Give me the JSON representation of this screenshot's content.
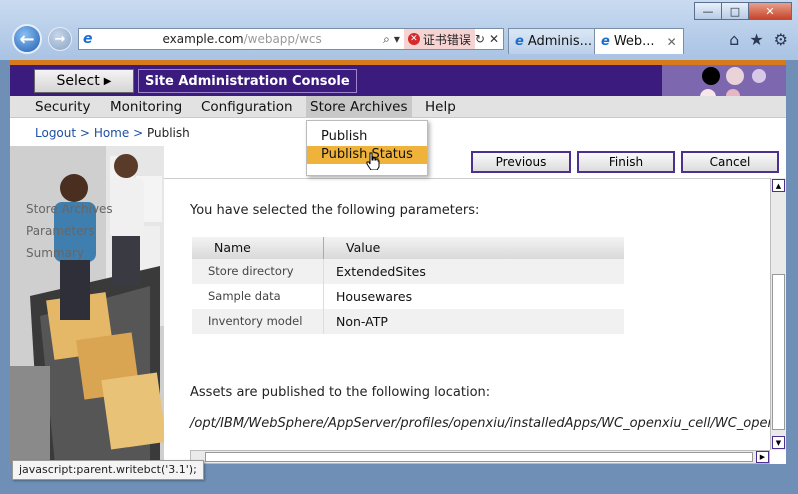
{
  "browser": {
    "address": {
      "url": "example.com",
      "url_tail": "/webapp/wcs",
      "cert_error": "证书错误"
    },
    "tabs": [
      {
        "label": "Adminis...",
        "active": false
      },
      {
        "label": "Web...",
        "active": true
      }
    ],
    "window_controls": {
      "minimize": "—",
      "maximize": "□",
      "close": "✕"
    },
    "status_tip": "javascript:parent.writebct('3.1');"
  },
  "header": {
    "select_label": "Select",
    "console_title": "Site Administration Console"
  },
  "menu": {
    "items": [
      "Security",
      "Monitoring",
      "Configuration",
      "Store Archives",
      "Help"
    ],
    "open_item": "Store Archives",
    "dropdown": [
      "Publish",
      "Publish Status"
    ],
    "highlighted": "Publish Status"
  },
  "breadcrumb": {
    "logout": "Logout",
    "home": "Home",
    "current": "Publish",
    "sep": ">"
  },
  "sidebar": {
    "steps": [
      "Store Archives",
      "Parameters",
      "Summary"
    ]
  },
  "actions": {
    "previous": "Previous",
    "finish": "Finish",
    "cancel": "Cancel"
  },
  "main": {
    "intro": "You have selected the following parameters:",
    "table": {
      "headers": [
        "Name",
        "Value"
      ],
      "rows": [
        {
          "name": "Store directory",
          "value": "ExtendedSites"
        },
        {
          "name": "Sample data",
          "value": "Housewares"
        },
        {
          "name": "Inventory model",
          "value": "Non-ATP"
        }
      ]
    },
    "assets_label": "Assets are published to the following location:",
    "assets_path": "/opt/IBM/WebSphere/AppServer/profiles/openxiu/installedApps/WC_openxiu_cell/WC_openxiu.ear/Stores.war"
  },
  "colors": {
    "banner": "#3b1c7e",
    "accent_orange": "#d77a1e",
    "menu_highlight": "#efb33b"
  }
}
